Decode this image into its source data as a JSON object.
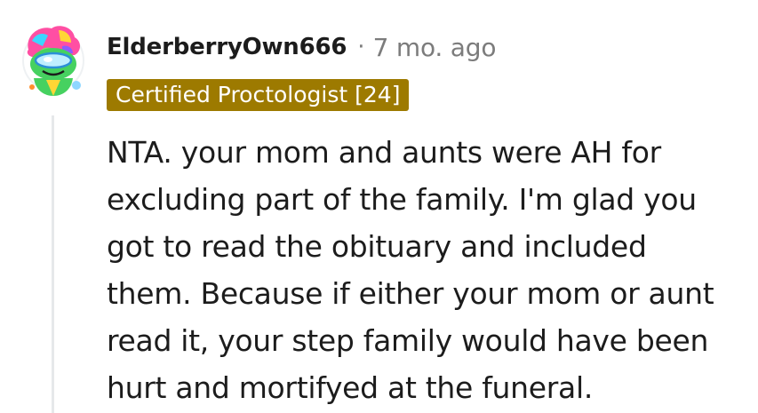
{
  "comment": {
    "avatar_icon": "frog-avatar-icon",
    "author": "ElderberryOwn666",
    "separator": "·",
    "timestamp": "7 mo. ago",
    "flair": "Certified Proctologist [24]",
    "flair_color": "#9d7a00",
    "body_lines": [
      "NTA. your mom and aunts were AH for",
      "excluding part of the family. I'm glad you",
      "got to read the obituary and included",
      "them. Because if either your mom or aunt",
      "read it, your step family would have been",
      "hurt and mortifyed at the funeral."
    ]
  }
}
